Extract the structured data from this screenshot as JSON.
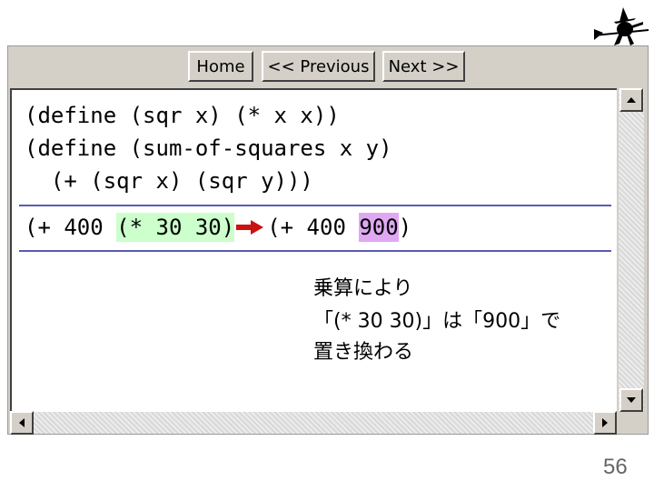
{
  "toolbar": {
    "home_label": "Home",
    "previous_label": "<< Previous",
    "next_label": "Next >>"
  },
  "code": {
    "line1": "(define (sqr x) (* x x))",
    "line2": "(define (sum-of-squares x y)",
    "line3": "  (+ (sqr x) (sqr y)))"
  },
  "evaluation": {
    "before_prefix": "(+ 400 ",
    "before_highlight": "(* 30 30)",
    "after_prefix": "(+ 400 ",
    "after_highlight": "900",
    "after_suffix": ")"
  },
  "note": {
    "line1": "乗算により",
    "line2": "「(* 30 30)」は「900」で",
    "line3": "置き換わる"
  },
  "page_number": "56",
  "colors": {
    "highlight_green": "#ccffcc",
    "highlight_purple": "#e0a8f2",
    "arrow_red": "#cc1111",
    "divider_blue": "#5a5ab4"
  },
  "icons": {
    "logo": "witch-on-broom-icon",
    "scroll_up": "triangle-up-icon",
    "scroll_down": "triangle-down-icon",
    "scroll_left": "triangle-left-icon",
    "scroll_right": "triangle-right-icon",
    "arrow": "red-right-arrow-icon"
  }
}
